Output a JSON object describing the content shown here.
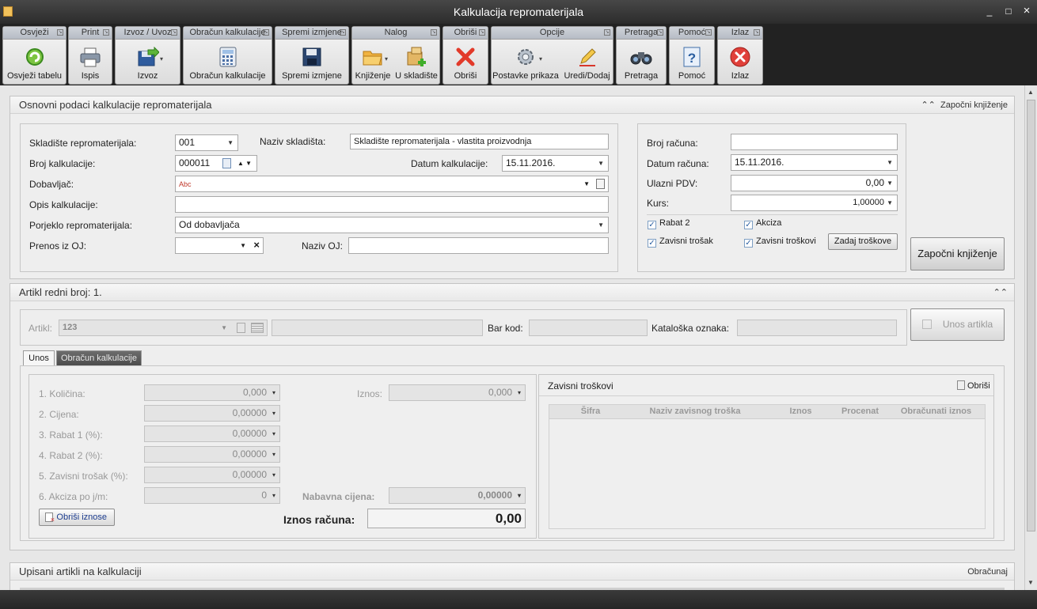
{
  "window": {
    "title": "Kalkulacija repromaterijala",
    "minimize": "_",
    "maximize": "□",
    "close": "×"
  },
  "ribbon": {
    "groups": [
      {
        "label": "Osvježi",
        "buttons": [
          {
            "label": "Osvježi tabelu"
          }
        ]
      },
      {
        "label": "Print",
        "buttons": [
          {
            "label": "Ispis"
          }
        ]
      },
      {
        "label": "Izvoz / Uvoz",
        "buttons": [
          {
            "label": "Izvoz"
          }
        ]
      },
      {
        "label": "Obračun kalkulacije",
        "buttons": [
          {
            "label": "Obračun kalkulacije"
          }
        ]
      },
      {
        "label": "Spremi izmjene",
        "buttons": [
          {
            "label": "Spremi izmjene"
          }
        ]
      },
      {
        "label": "Nalog",
        "buttons": [
          {
            "label": "Knjiženje"
          },
          {
            "label": "U skladište"
          }
        ]
      },
      {
        "label": "Obriši",
        "buttons": [
          {
            "label": "Obriši"
          }
        ]
      },
      {
        "label": "Opcije",
        "buttons": [
          {
            "label": "Postavke prikaza"
          },
          {
            "label": "Uredi/Dodaj"
          }
        ]
      },
      {
        "label": "Pretraga",
        "buttons": [
          {
            "label": "Pretraga"
          }
        ]
      },
      {
        "label": "Pomoć",
        "buttons": [
          {
            "label": "Pomoć"
          }
        ]
      },
      {
        "label": "Izlaz",
        "buttons": [
          {
            "label": "Izlaz"
          }
        ]
      }
    ]
  },
  "basic": {
    "title": "Osnovni podaci kalkulacije repromaterijala",
    "start_link": "Započni knjiženje",
    "skladiste_label": "Skladište repromaterijala:",
    "skladiste_value": "001",
    "naziv_skladista_label": "Naziv skladišta:",
    "naziv_skladista_value": "Skladište repromaterijala - vlastita proizvodnja",
    "broj_kalk_label": "Broj kalkulacije:",
    "broj_kalk_value": "000011",
    "datum_kalk_label": "Datum kalkulacije:",
    "datum_kalk_value": "15.11.2016.",
    "dobavljac_label": "Dobavljač:",
    "dobavljac_value": "Abc",
    "opis_label": "Opis kalkulacije:",
    "opis_value": "",
    "porijeklo_label": "Porjeklo repromaterijala:",
    "porijeklo_value": "Od dobavljača",
    "prenos_label": "Prenos iz OJ:",
    "prenos_value": "",
    "naziv_oj_label": "Naziv OJ:",
    "naziv_oj_value": "",
    "broj_racuna_label": "Broj računa:",
    "broj_racuna_value": "",
    "datum_racuna_label": "Datum računa:",
    "datum_racuna_value": "15.11.2016.",
    "ulazni_pdv_label": "Ulazni PDV:",
    "ulazni_pdv_value": "0,00",
    "kurs_label": "Kurs:",
    "kurs_value": "1,00000",
    "rabat2": "Rabat 2",
    "akciza": "Akciza",
    "zavisni_trosak": "Zavisni trošak",
    "zavisni_troskovi": "Zavisni troškovi",
    "zadaj_troskove": "Zadaj troškove",
    "start_button": "Započni knjiženje"
  },
  "artikl": {
    "title": "Artikl redni broj: 1.",
    "artikl_label": "Artikl:",
    "artikl_value": "123",
    "bar_kod_label": "Bar kod:",
    "kataloska_label": "Kataloška oznaka:",
    "unos_button": "Unos artikla",
    "tabs": [
      "Unos",
      "Obračun kalkulacije"
    ],
    "kolicina_label": "1. Količina:",
    "kolicina_value": "0,000",
    "cijena_label": "2. Cijena:",
    "cijena_value": "0,00000",
    "rabat1_label": "3. Rabat 1 (%):",
    "rabat1_value": "0,00000",
    "rabat2_label": "4. Rabat 2  (%):",
    "rabat2_value": "0,00000",
    "zavisni_label": "5. Zavisni trošak  (%):",
    "zavisni_value": "0,00000",
    "akciza_label": "6. Akciza po j/m:",
    "akciza_value": "0",
    "iznos_label": "Iznos:",
    "iznos_value": "0,000",
    "nabavna_label": "Nabavna cijena:",
    "nabavna_value": "0,00000",
    "obrisi_iznose": "Obriši iznose",
    "iznos_racuna_label": "Iznos računa:",
    "iznos_racuna_value": "0,00",
    "zavisni_title": "Zavisni troškovi",
    "zavisni_obrisi": "Obriši",
    "columns": [
      "Šifra",
      "Naziv zavisnog troška",
      "Iznos",
      "Procenat",
      "Obračunati iznos"
    ]
  },
  "upisani": {
    "title": "Upisani artikli na kalkulaciji",
    "obracunaj": "Obračunaj"
  }
}
